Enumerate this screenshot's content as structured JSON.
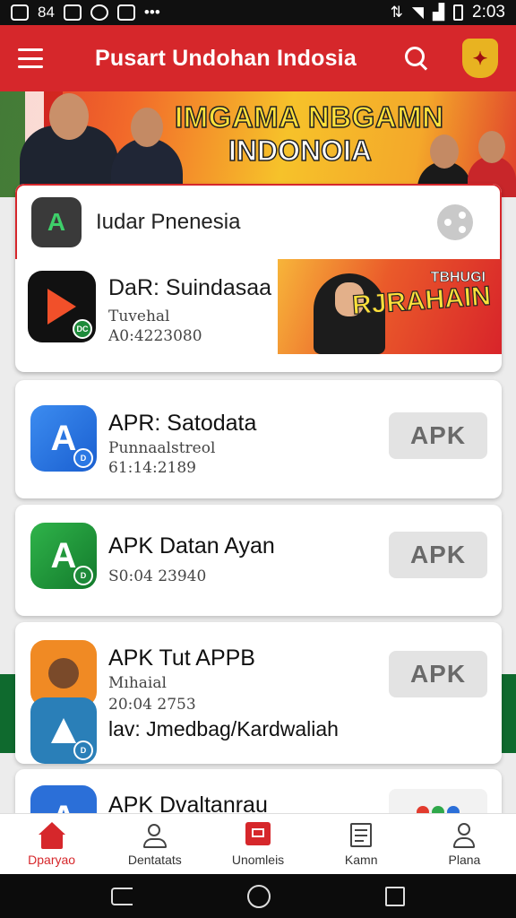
{
  "status_bar": {
    "left_text": "84",
    "time": "2:03"
  },
  "app_bar": {
    "title": "Pusart Undohan Indosia"
  },
  "banner": {
    "line1": "IMGAMA NBGAMN",
    "line2": "INDONOIA"
  },
  "featured": {
    "search_text": "Iudar Pnenesia",
    "app_name": "DaR: Suindasaa",
    "app_sub": "Tuvehal",
    "app_date": "A0:4223080",
    "promo_line1": "TBHUGI",
    "promo_line2": "RJRAHAIN"
  },
  "apps": [
    {
      "name": "APR: Satodata",
      "sub": "Punnaalstreol",
      "date": "61:14:2189",
      "button": "APK",
      "icon_color": "#2b78e4"
    },
    {
      "name": "APK Datan Ayan",
      "sub": "",
      "date": "S0:04 23940",
      "button": "APK",
      "icon_color": "#1f9a3c"
    },
    {
      "name": "APK Tut APPB",
      "sub": "Mıhaial",
      "date": "20:04 2753",
      "extra": "lav: Jmedbag/Kardwaliah",
      "button": "APK",
      "icon_color": "#f08a24"
    },
    {
      "name": "APK Dvaltanrau",
      "button": "",
      "icon_color": "#2b6fd8"
    }
  ],
  "bottom_nav": [
    {
      "label": "Dparyao",
      "icon": "home-icon"
    },
    {
      "label": "Dentatats",
      "icon": "people-icon"
    },
    {
      "label": "Unomleis",
      "icon": "book-icon"
    },
    {
      "label": "Kamn",
      "icon": "list-icon"
    },
    {
      "label": "Plana",
      "icon": "person-icon"
    }
  ],
  "colors": {
    "brand_red": "#d6272b",
    "apk_gray": "#e3e3e3"
  }
}
